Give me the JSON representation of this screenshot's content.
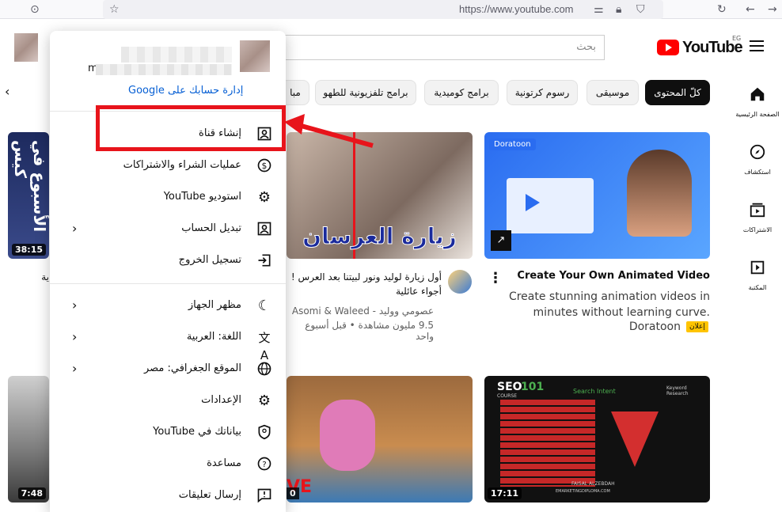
{
  "browser": {
    "url": "https://www.youtube.com",
    "icons": [
      "pocket-icon",
      "bookmark-star-icon",
      "permissions-icon",
      "lock-icon",
      "shield-icon",
      "reload-icon",
      "back-icon",
      "forward-icon"
    ]
  },
  "header": {
    "search_placeholder": "بحث",
    "logo_text": "YouTube",
    "region": "EG"
  },
  "account_menu": {
    "email_partial": "m",
    "manage_account": "إدارة حسابك على Google",
    "items_group1": [
      {
        "label": "إنشاء قناة",
        "icon": "create-channel-icon"
      },
      {
        "label": "عمليات الشراء والاشتراكات",
        "icon": "dollar-icon"
      },
      {
        "label": "استوديو YouTube",
        "icon": "studio-gear-icon"
      },
      {
        "label": "تبديل الحساب",
        "icon": "switch-account-icon",
        "has_chevron": true
      },
      {
        "label": "تسجيل الخروج",
        "icon": "sign-out-icon"
      }
    ],
    "items_group2": [
      {
        "label": "مظهر الجهاز",
        "icon": "moon-icon",
        "has_chevron": true
      },
      {
        "label": "اللغة: العربية",
        "icon": "translate-icon",
        "has_chevron": true
      },
      {
        "label": "الموقع الجغرافي: مصر",
        "icon": "globe-icon",
        "has_chevron": true
      },
      {
        "label": "الإعدادات",
        "icon": "settings-gear-icon"
      },
      {
        "label": "بياناتك في YouTube",
        "icon": "privacy-shield-icon"
      },
      {
        "label": "مساعدة",
        "icon": "help-icon"
      },
      {
        "label": "إرسال تعليقات",
        "icon": "feedback-icon"
      }
    ]
  },
  "chips": [
    "كلّ المحتوى",
    "موسيقى",
    "رسوم كرتونية",
    "برامج كوميدية",
    "برامج تلفزيونية للطهو",
    "مبا"
  ],
  "sidebar": [
    {
      "label": "الصفحة الرئيسية",
      "icon": "home-icon"
    },
    {
      "label": "استكشاف",
      "icon": "explore-icon"
    },
    {
      "label": "الاشتراكات",
      "icon": "subscriptions-icon"
    },
    {
      "label": "المكتبة",
      "icon": "library-icon"
    }
  ],
  "videos": {
    "ad": {
      "title": "Create Your Own Animated Video",
      "description": "Create stunning animation videos in minutes without learning curve.",
      "advertiser": "Doratoon",
      "ad_badge": "إعلان",
      "brand_label": "Doratoon"
    },
    "v2": {
      "title_line1": "أول زيارة لوليد ونور لبيتنا بعد العرس !",
      "title_line2": "أجواء عائلية",
      "channel": "عصومي ووليد - Asomi & Waleed",
      "views": "9.5 مليون مشاهدة • قبل أسبوع واحد",
      "thumb_text": "زيارة العرسان"
    },
    "v1": {
      "duration": "38:15",
      "title_partial": "ية",
      "thumb_text": "الأسبوع في كيس"
    },
    "v4": {
      "duration": "7:48"
    },
    "v5": {
      "duration": "0",
      "thumb_text": "VE"
    },
    "v6": {
      "duration": "17:11",
      "seo_label": "SEO",
      "seo_num": "101",
      "seo_sub": "COURSE",
      "col1": "Search Intent",
      "col2": "Keyword Research",
      "footer_name": "FAISAL ALZEBDAH",
      "footer_site": "EMARKETINGDIPLOMA.COM"
    }
  },
  "colors": {
    "annotation_red": "#e8141b",
    "brand_red": "#ff0000",
    "link_blue": "#065fd4",
    "ad_yellow": "#ffc400"
  }
}
